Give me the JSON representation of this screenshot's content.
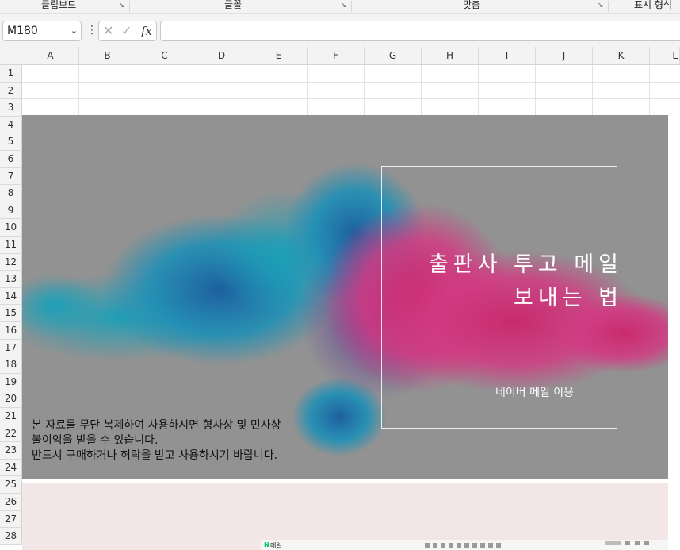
{
  "ribbon": {
    "groups": [
      "클립보드",
      "글꼴",
      "맞춤",
      "표시 형식"
    ]
  },
  "formula_bar": {
    "name_box": "M180",
    "name_box_dropdown": "⌄",
    "more_icon": "⋮",
    "cancel_icon": "✕",
    "enter_icon": "✓",
    "fx_label": "fx",
    "formula": ""
  },
  "columns": [
    "A",
    "B",
    "C",
    "D",
    "E",
    "F",
    "G",
    "H",
    "I",
    "J",
    "K",
    "L"
  ],
  "rows": [
    "1",
    "2",
    "3",
    "4",
    "5",
    "6",
    "7",
    "8",
    "9",
    "10",
    "11",
    "12",
    "13",
    "14",
    "15",
    "16",
    "17",
    "18",
    "19",
    "20",
    "21",
    "22",
    "23",
    "24",
    "25",
    "26",
    "27",
    "28"
  ],
  "banner": {
    "title_line1": "출판사 투고 메일",
    "title_line2": "보내는 법",
    "subtitle": "네이버 메일 이용",
    "notice_line1": "본 자료를 무단 복제하여 사용하시면 형사상 및 민사상",
    "notice_line2": "불이익을 받을 수 있습니다.",
    "notice_line3": "반드시 구매하거나 허락을 받고 사용하시기 바랍니다.",
    "bg_color": "#929292",
    "smoke_blue": "#1f8fb4",
    "smoke_pink": "#d0307a"
  },
  "embedded_taskbar": {
    "app_icon": "N",
    "app_label": "메일"
  }
}
